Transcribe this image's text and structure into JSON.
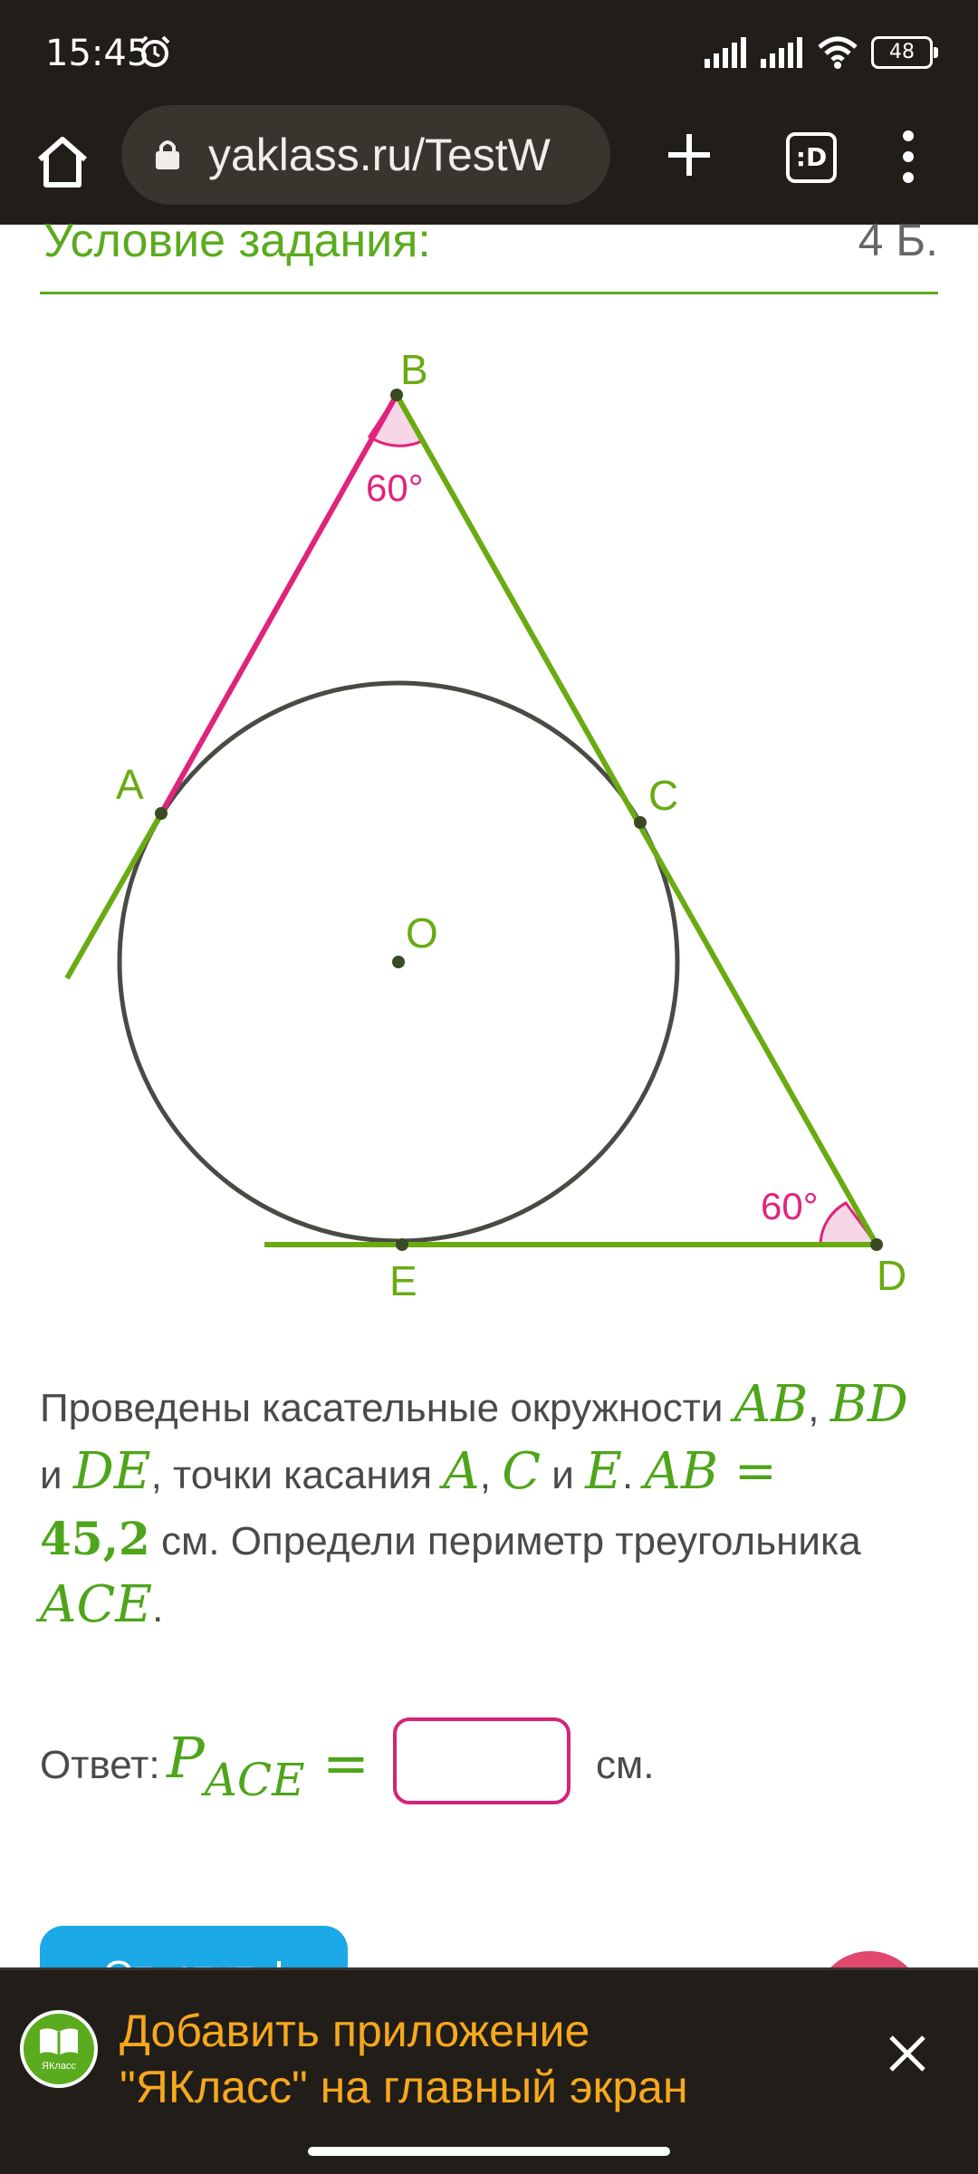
{
  "status_bar": {
    "time": "15:45",
    "battery": "48"
  },
  "browser": {
    "url": "yaklass.ru/TestW",
    "tabs_label": ":D"
  },
  "task": {
    "title": "Условие задания:",
    "points": "4 Б."
  },
  "diagram": {
    "points": {
      "B": "B",
      "A": "A",
      "C": "C",
      "O": "O",
      "E": "E",
      "D": "D"
    },
    "angle_b": "60°",
    "angle_d": "60°",
    "colors": {
      "green": "#6aab12",
      "pink": "#e0247c",
      "circle": "#4a4a44",
      "angle_fill": "#f7d6e6"
    }
  },
  "problem": {
    "t1": "Проведены касательные окружности ",
    "m_ab": "AB",
    "t2": ", ",
    "m_bd": "BD",
    "t3": " и ",
    "m_de": "DE",
    "t4": ", точки касания ",
    "m_a": "A",
    "t5": ", ",
    "m_c": "C",
    "t6": " и ",
    "m_e": "E",
    "t7": ". ",
    "m_ab_eq": "AB =",
    "m_val": "45,2",
    "t8": " см. Определи периметр треугольника ",
    "m_ace": "ACE",
    "t9": "."
  },
  "answer": {
    "label": "Ответ:",
    "p": "P",
    "sub": "ACE",
    "eq": "=",
    "value": "",
    "unit": "см."
  },
  "submit": {
    "label": "Ответить!"
  },
  "banner": {
    "logo_text": "ЯКласс",
    "line1": "Добавить приложение",
    "line2": "\"ЯКласс\" на главный экран"
  }
}
